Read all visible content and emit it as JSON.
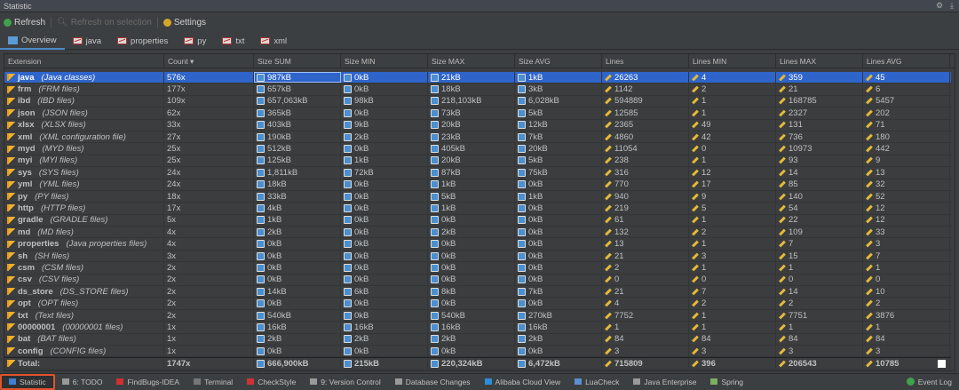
{
  "window": {
    "title": "Statistic"
  },
  "toolbar": {
    "refresh": "Refresh",
    "refresh_selection": "Refresh on selection",
    "settings": "Settings"
  },
  "tabs": [
    {
      "label": "Overview"
    },
    {
      "label": "java"
    },
    {
      "label": "properties"
    },
    {
      "label": "py"
    },
    {
      "label": "txt"
    },
    {
      "label": "xml"
    }
  ],
  "table": {
    "columns": [
      "Extension",
      "Count",
      "Size SUM",
      "Size MIN",
      "Size MAX",
      "Size AVG",
      "Lines",
      "Lines MIN",
      "Lines MAX",
      "Lines AVG"
    ],
    "sort_column": "Count",
    "sort_direction": "descending",
    "selected_row": 0,
    "rows": [
      [
        "java",
        "(Java classes)",
        "576x",
        "987kB",
        "0kB",
        "21kB",
        "1kB",
        "26263",
        "4",
        "359",
        "45"
      ],
      [
        "frm",
        "(FRM files)",
        "177x",
        "657kB",
        "0kB",
        "18kB",
        "3kB",
        "1142",
        "2",
        "21",
        "6"
      ],
      [
        "ibd",
        "(IBD files)",
        "109x",
        "657,063kB",
        "98kB",
        "218,103kB",
        "6,028kB",
        "594889",
        "1",
        "168785",
        "5457"
      ],
      [
        "json",
        "(JSON files)",
        "62x",
        "365kB",
        "0kB",
        "73kB",
        "5kB",
        "12585",
        "1",
        "2327",
        "202"
      ],
      [
        "xlsx",
        "(XLSX files)",
        "33x",
        "403kB",
        "9kB",
        "20kB",
        "12kB",
        "2365",
        "49",
        "131",
        "71"
      ],
      [
        "xml",
        "(XML configuration file)",
        "27x",
        "190kB",
        "2kB",
        "23kB",
        "7kB",
        "4860",
        "42",
        "736",
        "180"
      ],
      [
        "myd",
        "(MYD files)",
        "25x",
        "512kB",
        "0kB",
        "405kB",
        "20kB",
        "11054",
        "0",
        "10973",
        "442"
      ],
      [
        "myi",
        "(MYI files)",
        "25x",
        "125kB",
        "1kB",
        "20kB",
        "5kB",
        "238",
        "1",
        "93",
        "9"
      ],
      [
        "sys",
        "(SYS files)",
        "24x",
        "1,811kB",
        "72kB",
        "87kB",
        "75kB",
        "316",
        "12",
        "14",
        "13"
      ],
      [
        "yml",
        "(YML files)",
        "24x",
        "18kB",
        "0kB",
        "1kB",
        "0kB",
        "770",
        "17",
        "85",
        "32"
      ],
      [
        "py",
        "(PY files)",
        "18x",
        "33kB",
        "0kB",
        "5kB",
        "1kB",
        "940",
        "9",
        "140",
        "52"
      ],
      [
        "http",
        "(HTTP files)",
        "17x",
        "4kB",
        "0kB",
        "1kB",
        "0kB",
        "219",
        "5",
        "54",
        "12"
      ],
      [
        "gradle",
        "(GRADLE files)",
        "5x",
        "1kB",
        "0kB",
        "0kB",
        "0kB",
        "61",
        "1",
        "22",
        "12"
      ],
      [
        "md",
        "(MD files)",
        "4x",
        "2kB",
        "0kB",
        "2kB",
        "0kB",
        "132",
        "2",
        "109",
        "33"
      ],
      [
        "properties",
        "(Java properties files)",
        "4x",
        "0kB",
        "0kB",
        "0kB",
        "0kB",
        "13",
        "1",
        "7",
        "3"
      ],
      [
        "sh",
        "(SH files)",
        "3x",
        "0kB",
        "0kB",
        "0kB",
        "0kB",
        "21",
        "3",
        "15",
        "7"
      ],
      [
        "csm",
        "(CSM files)",
        "2x",
        "0kB",
        "0kB",
        "0kB",
        "0kB",
        "2",
        "1",
        "1",
        "1"
      ],
      [
        "csv",
        "(CSV files)",
        "2x",
        "0kB",
        "0kB",
        "0kB",
        "0kB",
        "0",
        "0",
        "0",
        "0"
      ],
      [
        "ds_store",
        "(DS_STORE files)",
        "2x",
        "14kB",
        "6kB",
        "8kB",
        "7kB",
        "21",
        "7",
        "14",
        "10"
      ],
      [
        "opt",
        "(OPT files)",
        "2x",
        "0kB",
        "0kB",
        "0kB",
        "0kB",
        "4",
        "2",
        "2",
        "2"
      ],
      [
        "txt",
        "(Text files)",
        "2x",
        "540kB",
        "0kB",
        "540kB",
        "270kB",
        "7752",
        "1",
        "7751",
        "3876"
      ],
      [
        "00000001",
        "(00000001 files)",
        "1x",
        "16kB",
        "16kB",
        "16kB",
        "16kB",
        "1",
        "1",
        "1",
        "1"
      ],
      [
        "bat",
        "(BAT files)",
        "1x",
        "2kB",
        "2kB",
        "2kB",
        "2kB",
        "84",
        "84",
        "84",
        "84"
      ],
      [
        "config",
        "(CONFIG files)",
        "1x",
        "0kB",
        "0kB",
        "0kB",
        "0kB",
        "3",
        "3",
        "3",
        "3"
      ]
    ],
    "total": [
      "Total:",
      "1747x",
      "666,900kB",
      "215kB",
      "220,324kB",
      "6,472kB",
      "715809",
      "396",
      "206543",
      "10785"
    ]
  },
  "statusbar": {
    "items": [
      "Statistic",
      "6: TODO",
      "FindBugs-IDEA",
      "Terminal",
      "CheckStyle",
      "9: Version Control",
      "Database Changes",
      "Alibaba Cloud View",
      "LuaCheck",
      "Java Enterprise",
      "Spring"
    ],
    "event_log": "Event Log",
    "active": "Statistic"
  },
  "colors": {
    "selection": "#2f65ca",
    "highlight_border": "#e0542c",
    "tab_underline": "#4a88c7"
  }
}
